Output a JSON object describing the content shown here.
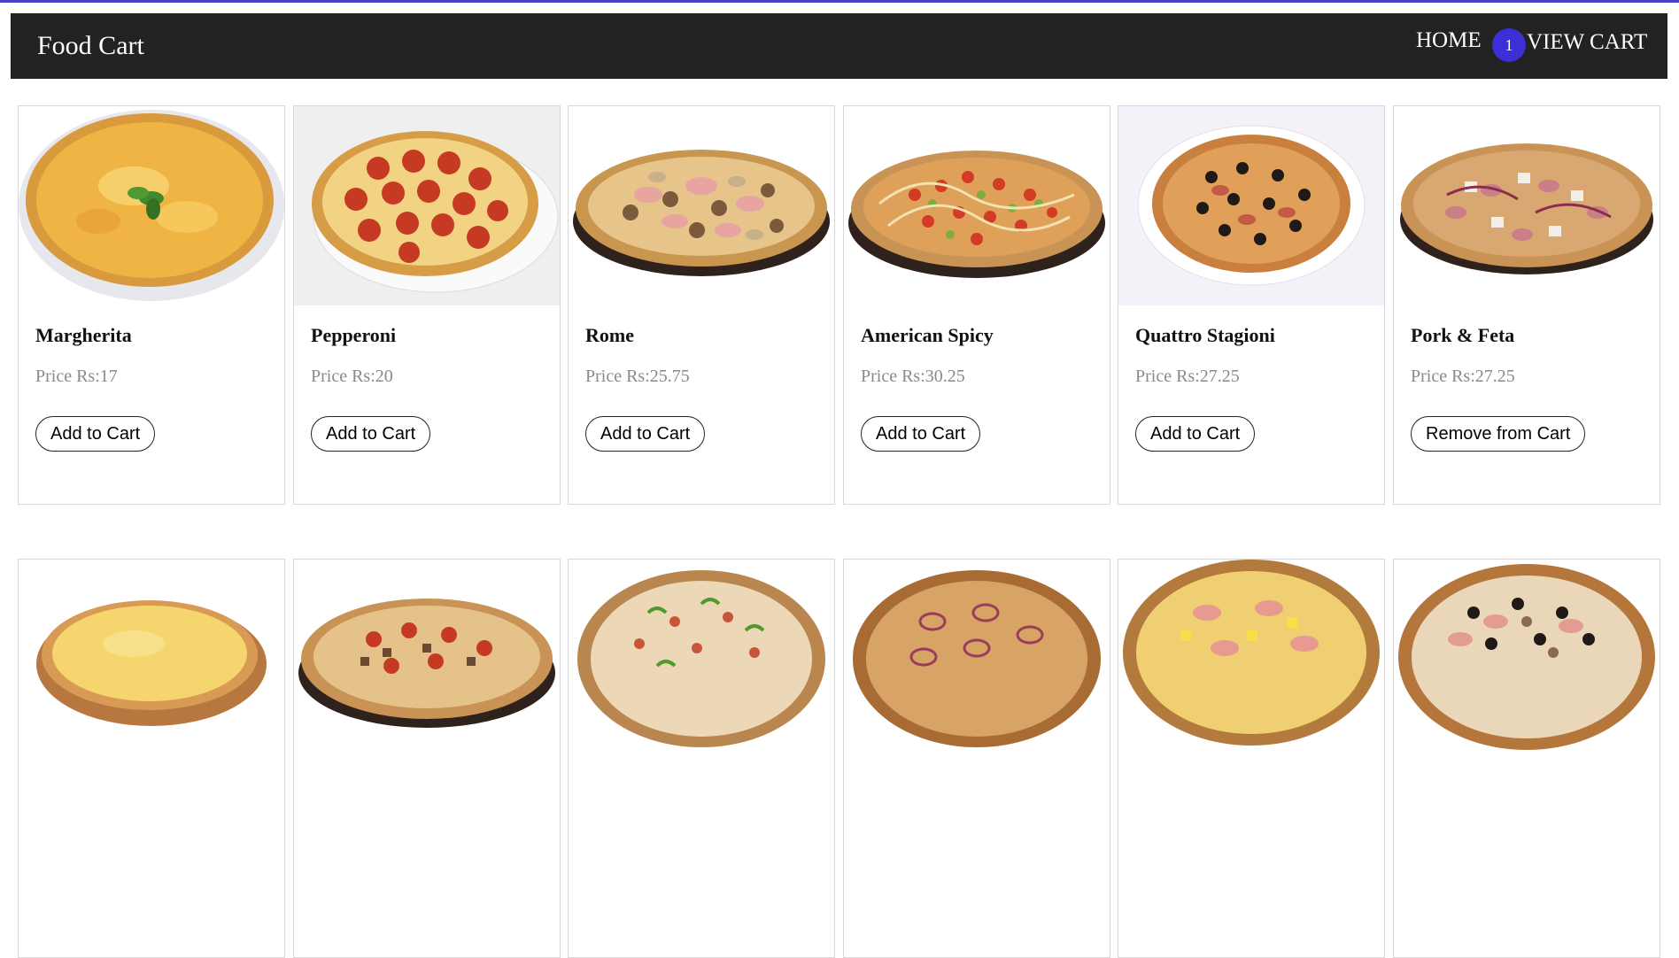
{
  "brand": "Food Cart",
  "nav": {
    "home": "HOME",
    "cart_count": "1",
    "view_cart": "VIEW CART"
  },
  "colors": {
    "navbar": "#222222",
    "badge": "#3d2fd6",
    "price_text": "#8a8a8a"
  },
  "products": [
    {
      "name": "Margherita",
      "price": "Price Rs:17",
      "button": "Add to Cart",
      "image": "pizza-margherita-icon"
    },
    {
      "name": "Pepperoni",
      "price": "Price Rs:20",
      "button": "Add to Cart",
      "image": "pizza-pepperoni-icon"
    },
    {
      "name": "Rome",
      "price": "Price Rs:25.75",
      "button": "Add to Cart",
      "image": "pizza-rome-icon"
    },
    {
      "name": "American Spicy",
      "price": "Price Rs:30.25",
      "button": "Add to Cart",
      "image": "pizza-american-spicy-icon"
    },
    {
      "name": "Quattro Stagioni",
      "price": "Price Rs:27.25",
      "button": "Add to Cart",
      "image": "pizza-quattro-stagioni-icon"
    },
    {
      "name": "Pork & Feta",
      "price": "Price Rs:27.25",
      "button": "Remove from Cart",
      "image": "pizza-pork-feta-icon"
    }
  ],
  "products_row2": [
    {
      "image": "pizza-cheese-icon"
    },
    {
      "image": "pizza-meat-icon"
    },
    {
      "image": "pizza-vegetable-icon"
    },
    {
      "image": "pizza-onion-icon"
    },
    {
      "image": "pizza-hawaiian-icon"
    },
    {
      "image": "pizza-olive-ham-icon"
    }
  ]
}
